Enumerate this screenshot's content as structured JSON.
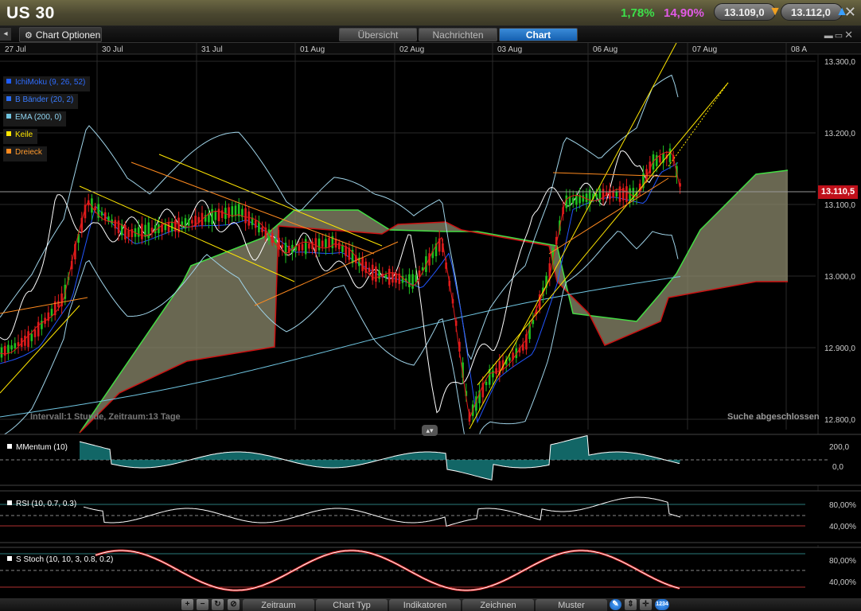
{
  "header": {
    "title": "US 30",
    "change_pct": "1,78%",
    "change_pct2": "14,90%",
    "sell_quote": "13.109,0",
    "buy_quote": "13.112,0",
    "close_glyph": "✕"
  },
  "tabs": {
    "chart_options": "Chart Optionen",
    "items": [
      "Übersicht",
      "Nachrichten",
      "Chart"
    ],
    "active": "Chart"
  },
  "x_axis_labels": [
    "27 Jul",
    "30 Jul",
    "31 Jul",
    "01 Aug",
    "02 Aug",
    "03 Aug",
    "06 Aug",
    "07 Aug",
    "08 A"
  ],
  "y_axis_labels": [
    "13.300,0",
    "13.200,0",
    "13.100,0",
    "13.000,0",
    "12.900,0",
    "12.800,0"
  ],
  "current_price": "13.110,5",
  "legend": [
    {
      "label": "IchiMoku (9, 26, 52)",
      "color": "#1e5cff"
    },
    {
      "label": "B Bänder (20, 2)",
      "color": "#2a6cf0"
    },
    {
      "label": "EMA (200, 0)",
      "color": "#6fc4e0"
    },
    {
      "label": "Keile",
      "color": "#ffe600"
    },
    {
      "label": "Dreieck",
      "color": "#ff8a1e"
    }
  ],
  "status_left": "Intervall:1 Stunde, Zeitraum:13 Tage",
  "status_right": "Suche abgeschlossen",
  "indicators": {
    "momentum": {
      "label": "MMentum (10)",
      "axis": [
        "200,0",
        "0,0"
      ]
    },
    "rsi": {
      "label": "RSI (10, 0.7, 0.3)",
      "axis": [
        "80,00%",
        "40,00%"
      ]
    },
    "stoch": {
      "label": "S Stoch (10, 10, 3, 0.8, 0.2)",
      "axis": [
        "80,00%",
        "40,00%"
      ]
    }
  },
  "toolbar": {
    "menus": [
      "Zeitraum",
      "Chart Typ",
      "Indikatoren",
      "Zeichnen",
      "Muster"
    ],
    "icons": [
      "zoom-in-icon",
      "zoom-out-icon",
      "refresh-icon",
      "reset-icon"
    ]
  },
  "colors": {
    "bull": "#1fc21f",
    "bear": "#e01b1b",
    "cloud": "#8c8a6c",
    "cloud_edge_up": "#44dd44",
    "cloud_edge_down": "#cc1111",
    "tenkan": "#e01b1b",
    "kijun": "#2255ff",
    "boll": "#9fd3e8",
    "ema": "#6fc4e0",
    "wedge": "#ffe600",
    "triangle": "#ff8a1e"
  }
}
